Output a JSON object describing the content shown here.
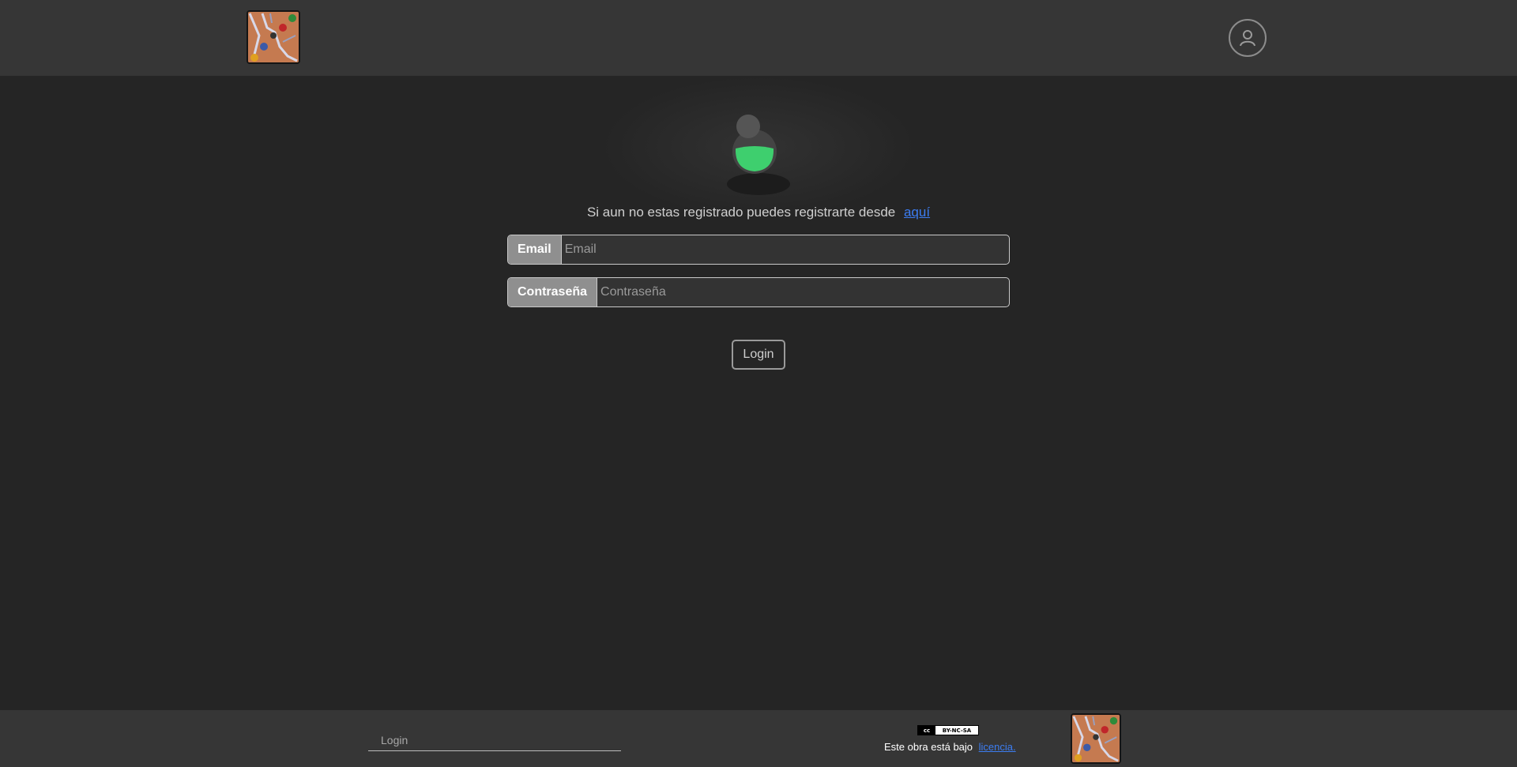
{
  "header": {
    "logo_icon": "game-board-logo-icon",
    "user_icon": "user-account-icon"
  },
  "main": {
    "register_prompt": "Si aun no estas registrado puedes registrarte desde",
    "register_link": "aquí",
    "email_label": "Email",
    "email_placeholder": "Email",
    "password_label": "Contraseña",
    "password_placeholder": "Contraseña",
    "login_button": "Login",
    "avatar_icon": "user-avatar-icon",
    "avatar_accent": "#3ecf6e"
  },
  "footer": {
    "login_link": "Login",
    "cc_badge_text": "BY-NC-SA",
    "cc_symbol": "cc",
    "license_text": "Este obra está bajo",
    "license_link": "licencia."
  }
}
